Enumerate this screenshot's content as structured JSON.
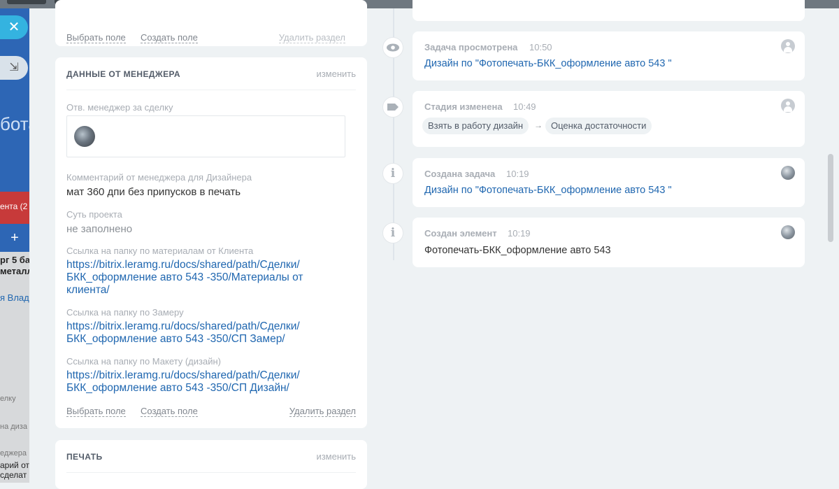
{
  "colors": {
    "accent": "#2067b0",
    "bg": "#eef2f4",
    "close": "#34b3e0"
  },
  "background": {
    "words": [
      "бота",
      "ента (2",
      "рг 5 ба",
      "металл",
      "я Влад",
      "елку",
      "на диза",
      "еджера",
      "арий от",
      "сделат"
    ],
    "plus": "+"
  },
  "top_card": {
    "select_field": "Выбрать поле",
    "create_field": "Создать поле",
    "delete_section": "Удалить раздел"
  },
  "manager_card": {
    "title": "ДАННЫЕ ОТ МЕНЕДЖЕРА",
    "edit": "изменить",
    "fields": [
      {
        "label": "Отв. менеджер за сделку"
      },
      {
        "label": "Комментарий от менеджера для Дизайнера",
        "value": "мат 360 дпи без припусков в печать"
      },
      {
        "label": "Суть проекта",
        "value": "не заполнено"
      },
      {
        "label": "Ссылка на папку по материалам от Клиента",
        "value": "https://bitrix.leramg.ru/docs/shared/path/Сделки/БКК_оформление авто 543 -350/Материалы от клиента/"
      },
      {
        "label": "Ссылка на папку по Замеру",
        "value": "https://bitrix.leramg.ru/docs/shared/path/Сделки/БКК_оформление авто 543 -350/СП Замер/"
      },
      {
        "label": "Ссылка на папку по Макету (дизайн)",
        "value": "https://bitrix.leramg.ru/docs/shared/path/Сделки/БКК_оформление авто 543 -350/СП Дизайн/"
      }
    ],
    "select_field": "Выбрать поле",
    "create_field": "Создать поле",
    "delete_section": "Удалить раздел"
  },
  "print_card": {
    "title": "ПЕЧАТЬ",
    "edit": "изменить"
  },
  "timeline": [
    {
      "icon": "eye-icon",
      "title": "Задача просмотрена",
      "time": "10:50",
      "link": "Дизайн по \"Фотопечать-БКК_оформление авто 543 \""
    },
    {
      "icon": "tag-icon",
      "title": "Стадия изменена",
      "time": "10:49",
      "from": "Взять в работу дизайн",
      "arrow": "→",
      "to": "Оценка достаточности"
    },
    {
      "icon": "info-icon",
      "title": "Создана задача",
      "time": "10:19",
      "link": "Дизайн по \"Фотопечать-БКК_оформление авто 543 \""
    },
    {
      "icon": "info-icon",
      "title": "Создан элемент",
      "time": "10:19",
      "text": "Фотопечать-БКК_оформление авто 543"
    }
  ]
}
